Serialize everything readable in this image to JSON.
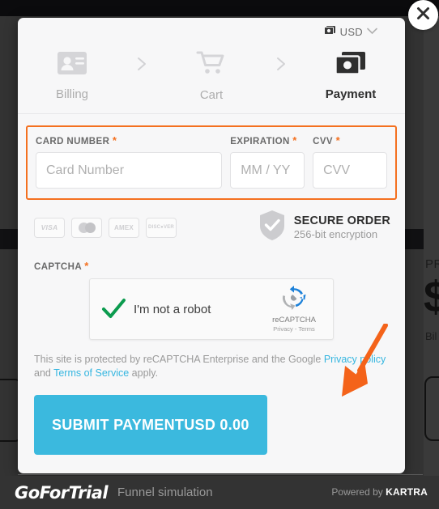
{
  "background": {
    "right_label": "PR",
    "right_price": "$",
    "right_sub": "Bil"
  },
  "modal": {
    "currency": {
      "icon": "money-icon",
      "label": "USD",
      "chevron": "chevron-down-icon"
    },
    "close_label": "×",
    "steps": [
      {
        "label": "Billing",
        "icon": "id-card-icon",
        "active": false
      },
      {
        "label": "Cart",
        "icon": "shopping-cart-icon",
        "active": false
      },
      {
        "label": "Payment",
        "icon": "money-bill-icon",
        "active": true
      }
    ],
    "step_separator": "›",
    "fields": {
      "card_number": {
        "label": "CARD NUMBER",
        "required": "*",
        "placeholder": "Card Number",
        "value": ""
      },
      "expiration": {
        "label": "EXPIRATION",
        "required": "*",
        "placeholder": "MM / YY",
        "value": ""
      },
      "cvv": {
        "label": "CVV",
        "required": "*",
        "placeholder": "CVV",
        "value": ""
      }
    },
    "brands": [
      {
        "name": "VISA",
        "icon": "visa-icon"
      },
      {
        "name": "",
        "icon": "mastercard-icon"
      },
      {
        "name": "AMEX",
        "icon": "amex-icon"
      },
      {
        "name": "DISC●VER",
        "icon": "discover-icon"
      }
    ],
    "secure": {
      "icon": "shield-check-icon",
      "title": "SECURE ORDER",
      "subtitle": "256-bit encryption"
    },
    "captcha": {
      "label": "CAPTCHA",
      "required": "*",
      "checkbox_label": "I'm not a robot",
      "checked": true,
      "logo_name": "reCAPTCHA",
      "logo_terms": "Privacy - Terms",
      "logo_icon": "recaptcha-icon"
    },
    "legal": {
      "text_1": "This site is protected by reCAPTCHA Enterprise and the Google ",
      "link_1": "Privacy policy",
      "text_2": " and ",
      "link_2": "Terms of Service",
      "text_3": " apply."
    },
    "submit": {
      "label": "SUBMIT PAYMENT",
      "amount": "USD 0.00",
      "color": "#3bb9de"
    }
  },
  "annotation": {
    "arrow_color": "#f4631a",
    "arrow_name": "orange-pointer-arrow"
  },
  "footer": {
    "logo": "GoForTrial",
    "funnel_name": "Funnel simulation",
    "powered_prefix": "Powered by ",
    "powered_brand": "KARTRA"
  }
}
